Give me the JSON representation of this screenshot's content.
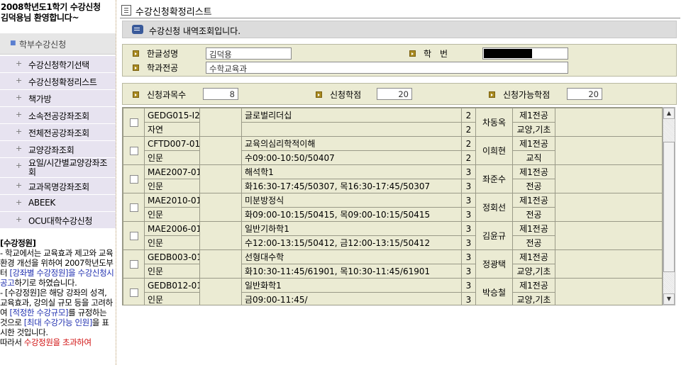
{
  "sidebar": {
    "welcome_line1": "2008학년도1학기 수강신청",
    "welcome_line2": "김덕용님 환영합니다~",
    "menu_head": "학부수강신청",
    "menu_head_icon": "square-bullet-icon",
    "items": [
      {
        "label": "수강신청학기선택"
      },
      {
        "label": "수강신청확정리스트"
      },
      {
        "label": "책가방"
      },
      {
        "label": "소속전공강좌조회"
      },
      {
        "label": "전체전공강좌조회"
      },
      {
        "label": "교양강좌조회"
      },
      {
        "label": "요일/시간별교양강좌조회"
      },
      {
        "label": "교과목명강좌조회"
      },
      {
        "label": "ABEEK"
      },
      {
        "label": "OCU대학수강신청"
      }
    ],
    "item_icon": "plus-icon",
    "notice": {
      "heading": "[수강정원]",
      "p1_a": "- 학교에서는 교육효과 제고와 교육환경 개선을 위하여 2007학년도부터 ",
      "p1_b": "[강좌별 수강정원]을 수강신청시 공고",
      "p1_c": "하기로 하였습니다.",
      "p2_a": "- [수강정원]은 해당 강좌의 성격, 교육효과, 강의실 규모 등을 고려하여 ",
      "p2_b": "[적정한 수강규모]",
      "p2_c": "를 규정하는 것으로 ",
      "p2_d": "[최대 수강가능 인원]",
      "p2_e": "을 표시한 것입니다.",
      "p3_a": "따라서 ",
      "p3_b": "수강정원을 초과하여"
    }
  },
  "main": {
    "title": "수강신청확정리스트",
    "title_icon": "document-icon",
    "info_icon": "speech-bubble-icon",
    "info_text": "수강신청 내역조회입니다.",
    "student": {
      "name_label": "한글성명",
      "name_value": "김덕용",
      "id_label": "학　번",
      "id_value": "",
      "major_label": "학과전공",
      "major_value": "수학교육과"
    },
    "summary": {
      "courses_label": "신청과목수",
      "courses_value": "8",
      "credits_label": "신청학점",
      "credits_value": "20",
      "max_label": "신청가능학점",
      "max_value": "20"
    },
    "courses": [
      {
        "code": "GEDG015-I2",
        "college": "자연",
        "name": "글로벌리더십",
        "time": "",
        "credit": "2",
        "credit2": "2",
        "prof": "차동옥",
        "type": "제1전공",
        "area": "교양,기초"
      },
      {
        "code": "CFTD007-01",
        "college": "인문",
        "name": "교육의심리학적이해",
        "time": "수09:00-10:50/50407",
        "credit": "2",
        "credit2": "2",
        "prof": "이희현",
        "type": "제1전공",
        "area": "교직"
      },
      {
        "code": "MAE2007-01",
        "college": "인문",
        "name": "해석학1",
        "time": "화16:30-17:45/50307, 목16:30-17:45/50307",
        "credit": "3",
        "credit2": "3",
        "prof": "좌준수",
        "type": "제1전공",
        "area": "전공"
      },
      {
        "code": "MAE2010-01",
        "college": "인문",
        "name": "미분방정식",
        "time": "화09:00-10:15/50415, 목09:00-10:15/50415",
        "credit": "3",
        "credit2": "3",
        "prof": "정회선",
        "type": "제1전공",
        "area": "전공"
      },
      {
        "code": "MAE2006-01",
        "college": "인문",
        "name": "일반기하학1",
        "time": "수12:00-13:15/50412, 금12:00-13:15/50412",
        "credit": "3",
        "credit2": "3",
        "prof": "김윤규",
        "type": "제1전공",
        "area": "전공"
      },
      {
        "code": "GEDB003-01",
        "college": "인문",
        "name": "선형대수학",
        "time": "화10:30-11:45/61901, 목10:30-11:45/61901",
        "credit": "3",
        "credit2": "3",
        "prof": "정광택",
        "type": "제1전공",
        "area": "교양,기초"
      },
      {
        "code": "GEDB012-01",
        "college": "인문",
        "name": "일반화학1",
        "time": "금09:00-11:45/",
        "credit": "3",
        "credit2": "3",
        "prof": "박승철",
        "type": "제1전공",
        "area": "교양,기초"
      }
    ],
    "scroll_up_icon": "arrow-up-icon",
    "scroll_down_icon": "arrow-down-icon"
  },
  "colors": {
    "panel_bg": "#ebebd3",
    "menu_bg": "#e7e3f0",
    "accent_blue": "#2030b0",
    "accent_red": "#d01010"
  }
}
